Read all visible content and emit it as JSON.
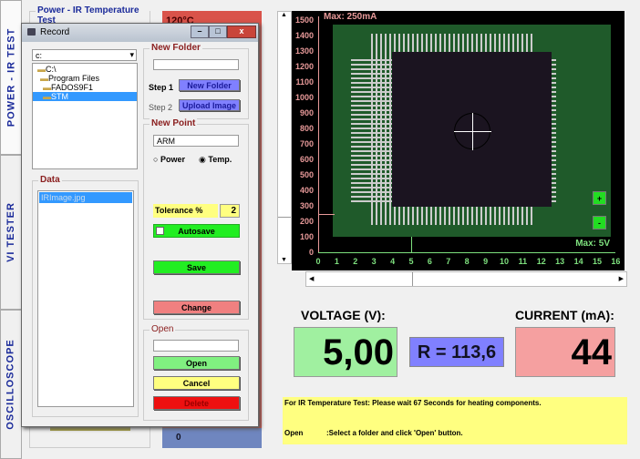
{
  "tabs": [
    {
      "label": "POWER - IR TEST"
    },
    {
      "label": "VI TESTER"
    },
    {
      "label": "OSCILLOSCOPE"
    }
  ],
  "background": {
    "group_title": "Power - IR Temperature Test",
    "temperature": "120°C",
    "blue_value": "0"
  },
  "dialog": {
    "title": "Record",
    "drive": "c:",
    "tree": [
      "C:\\",
      "Program Files",
      "FADOS9F1",
      "STM"
    ],
    "tree_selected": "STM",
    "data_group": "Data",
    "data_items": [
      "IRImage.jpg"
    ],
    "new_folder": {
      "title": "New Folder",
      "value": "",
      "step1": "Step 1",
      "step1_button": "New Folder",
      "step2": "Step 2",
      "step2_button": "Upload Image"
    },
    "new_point": {
      "title": "New Point",
      "value": "ARM",
      "radio_power": "Power",
      "radio_temp": "Temp.",
      "selected": "Temp.",
      "tolerance_label": "Tolerance %",
      "tolerance_value": "2",
      "autosave": "Autosave",
      "autosave_checked": false,
      "save": "Save",
      "change": "Change"
    },
    "open": {
      "title": "Open",
      "value": "",
      "open": "Open",
      "cancel": "Cancel",
      "delete": "Delete"
    }
  },
  "plot": {
    "max_current": "Max: 250mA",
    "max_voltage": "Max: 5V",
    "y_ticks": [
      "1500",
      "1400",
      "1300",
      "1200",
      "1100",
      "1000",
      "900",
      "800",
      "700",
      "600",
      "500",
      "400",
      "300",
      "200",
      "100",
      "0"
    ],
    "x_ticks": [
      "0",
      "1",
      "2",
      "3",
      "4",
      "5",
      "6",
      "7",
      "8",
      "9",
      "10",
      "11",
      "12",
      "13",
      "14",
      "15",
      "16"
    ],
    "current_marker": 250,
    "voltage_marker": 5,
    "zoom_in": "+",
    "zoom_out": "-"
  },
  "readout": {
    "voltage_label": "VOLTAGE (V):",
    "voltage": "5,00",
    "resistance": "R = 113,6",
    "current_label": "CURRENT (mA):",
    "current": "44"
  },
  "messages": {
    "line1": "For IR Temperature Test: Please wait 67 Seconds for heating components.",
    "line2_key": "Open",
    "line2_text": ":Select a folder and click 'Open' button."
  }
}
